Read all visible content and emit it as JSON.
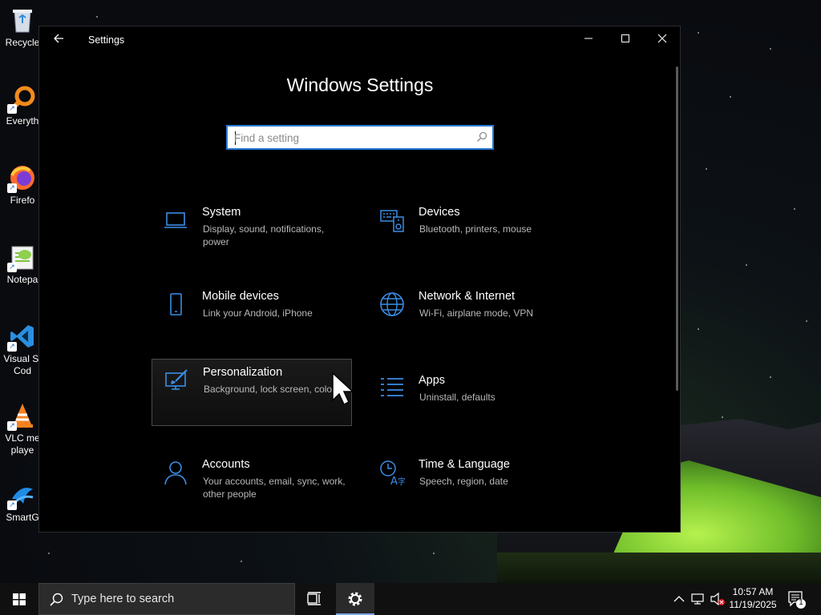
{
  "desktop": {
    "icons": [
      {
        "label": "Recycle",
        "icon": "recycle-bin-icon"
      },
      {
        "label": "Everyth",
        "icon": "everything-search-icon"
      },
      {
        "label": "Firefo",
        "icon": "firefox-icon"
      },
      {
        "label": "Notepa",
        "icon": "notepad-plus-plus-icon"
      },
      {
        "label": "Visual St",
        "label2": "Cod",
        "icon": "vscode-icon"
      },
      {
        "label": "VLC me",
        "label2": "playe",
        "icon": "vlc-icon"
      },
      {
        "label": "SmartG",
        "icon": "smartgit-icon"
      }
    ]
  },
  "window": {
    "title": "Settings",
    "back_icon": "back-arrow-icon",
    "controls": {
      "minimize": "—",
      "maximize": "☐",
      "close": "✕"
    }
  },
  "settings": {
    "heading": "Windows Settings",
    "search_placeholder": "Find a setting",
    "categories": [
      {
        "title": "System",
        "desc": "Display, sound, notifications, power",
        "icon": "laptop-icon"
      },
      {
        "title": "Devices",
        "desc": "Bluetooth, printers, mouse",
        "icon": "keyboard-speaker-icon"
      },
      {
        "title": "Mobile devices",
        "desc": "Link your Android, iPhone",
        "icon": "phone-icon"
      },
      {
        "title": "Network & Internet",
        "desc": "Wi-Fi, airplane mode, VPN",
        "icon": "globe-icon"
      },
      {
        "title": "Personalization",
        "desc": "Background, lock screen, colors",
        "icon": "paint-brush-icon"
      },
      {
        "title": "Apps",
        "desc": "Uninstall, defaults",
        "icon": "apps-list-icon"
      },
      {
        "title": "Accounts",
        "desc": "Your accounts, email, sync, work, other people",
        "icon": "person-icon"
      },
      {
        "title": "Time & Language",
        "desc": "Speech, region, date",
        "icon": "time-language-icon"
      }
    ]
  },
  "taskbar": {
    "search_placeholder": "Type here to search",
    "time": "10:57 AM",
    "date": "11/19/2025",
    "notification_count": "1"
  },
  "colors": {
    "accent": "#2b7bd6",
    "icon_blue": "#3a8ee6"
  }
}
